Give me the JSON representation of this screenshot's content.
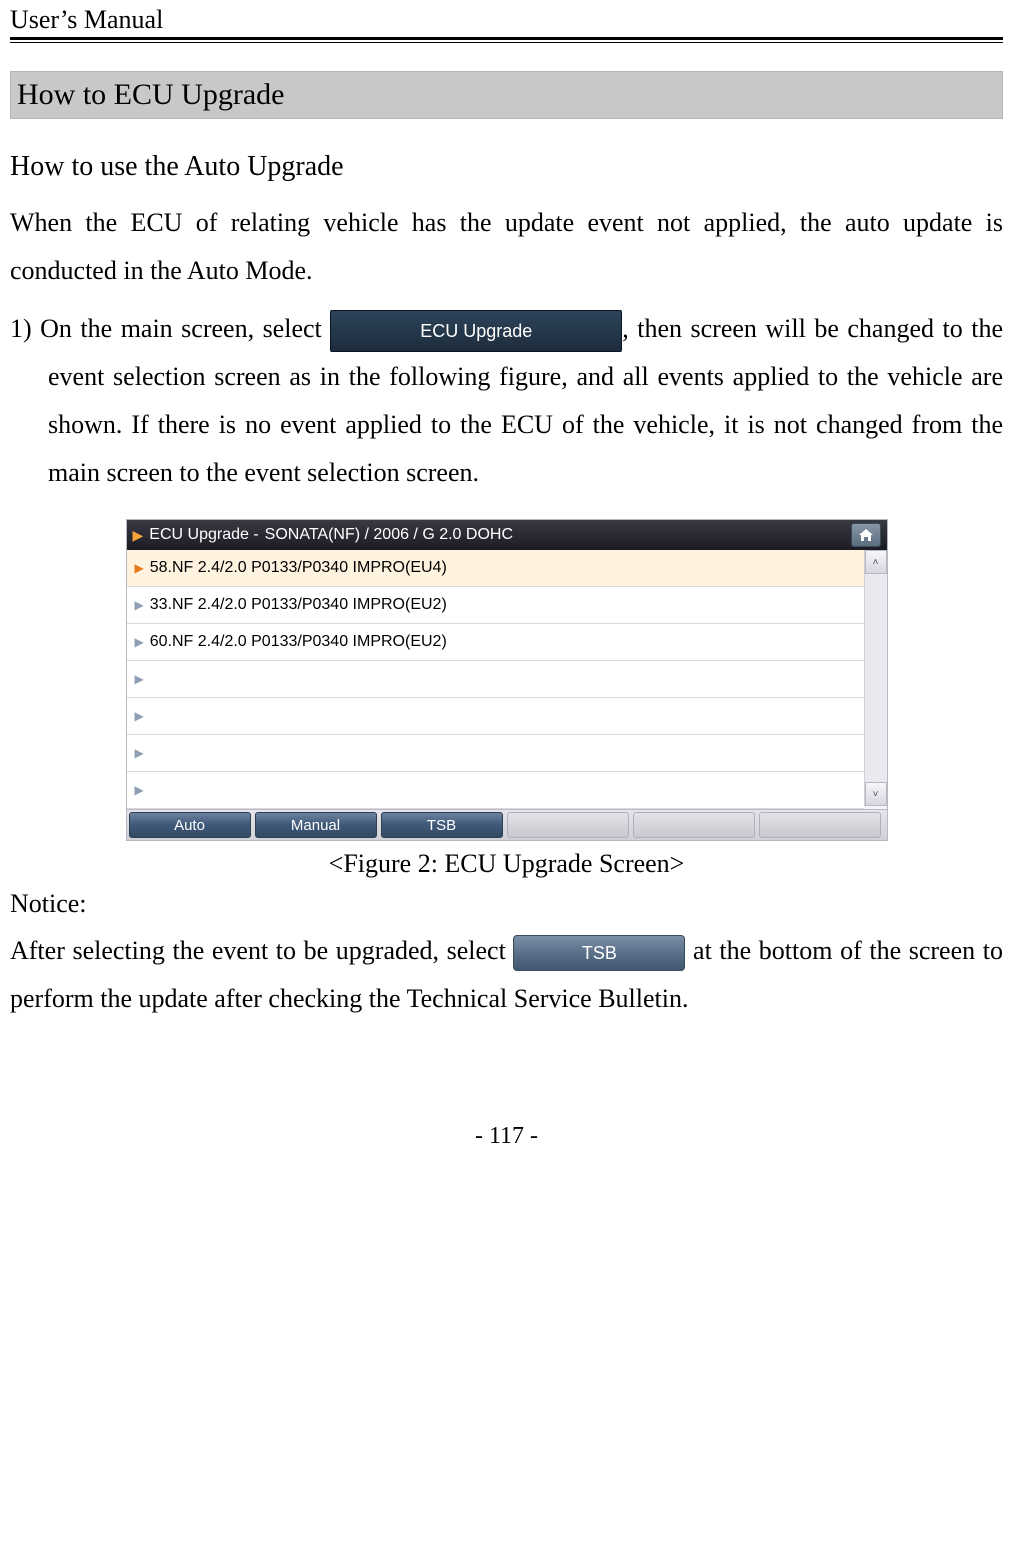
{
  "header": {
    "title": "User’s Manual"
  },
  "section": {
    "title": "How to ECU Upgrade"
  },
  "subheading": "How to use the Auto Upgrade",
  "intro": "When the ECU of relating vehicle has the update event not applied, the auto update is conducted in the Auto Mode.",
  "item1": {
    "prefix": "1) ",
    "text_a": "On the main screen, select ",
    "button_label": "ECU Upgrade",
    "text_b": ", then screen will be changed to the event selection screen as in the following figure, and all events applied to the vehicle are shown. If there is no event applied to the ECU of the vehicle, it is not changed from the main screen to the event selection screen."
  },
  "screenshot": {
    "title_prefix": "ECU Upgrade - ",
    "vehicle": "SONATA(NF) / 2006 / G 2.0 DOHC",
    "rows": [
      "58.NF 2.4/2.0 P0133/P0340 IMPRO(EU4)",
      "33.NF 2.4/2.0 P0133/P0340 IMPRO(EU2)",
      "60.NF 2.4/2.0 P0133/P0340 IMPRO(EU2)"
    ],
    "tabs": [
      "Auto",
      "Manual",
      "TSB"
    ]
  },
  "figure_caption": "<Figure 2: ECU Upgrade Screen>",
  "notice_label": "Notice:",
  "notice": {
    "text_a": "After selecting the event to be upgraded, select ",
    "button_label": "TSB",
    "text_b": " at the bottom of the screen to perform the update after checking the Technical Service Bulletin."
  },
  "footer": "- 117 -"
}
